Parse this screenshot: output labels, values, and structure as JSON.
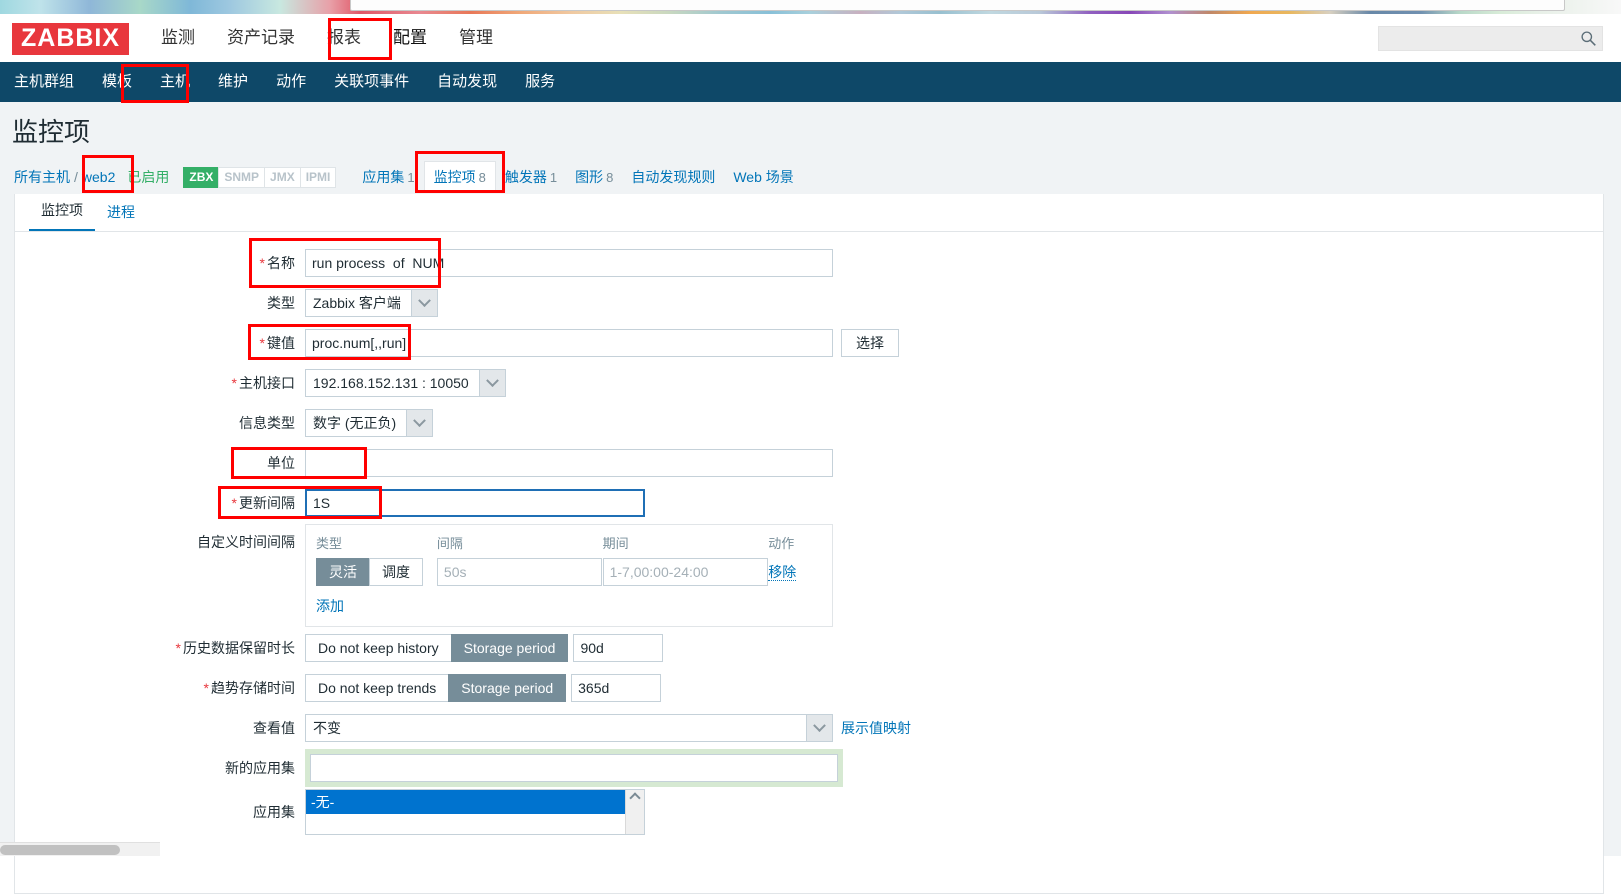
{
  "browser": {
    "wallpaper_strip": true
  },
  "header": {
    "logo": "ZABBIX",
    "menu": [
      {
        "label": "监测",
        "selected": false
      },
      {
        "label": "资产记录",
        "selected": false
      },
      {
        "label": "报表",
        "selected": false
      },
      {
        "label": "配置",
        "selected": true
      },
      {
        "label": "管理",
        "selected": false
      }
    ],
    "search": {
      "value": "",
      "placeholder": "",
      "icon": "search-icon"
    }
  },
  "subnav": {
    "items": [
      {
        "label": "主机群组",
        "selected": false
      },
      {
        "label": "模板",
        "selected": false
      },
      {
        "label": "主机",
        "selected": true
      },
      {
        "label": "维护",
        "selected": false
      },
      {
        "label": "动作",
        "selected": false
      },
      {
        "label": "关联项事件",
        "selected": false
      },
      {
        "label": "自动发现",
        "selected": false
      },
      {
        "label": "服务",
        "selected": false
      }
    ]
  },
  "page": {
    "title": "监控项"
  },
  "breadcrumb": {
    "all_hosts": "所有主机",
    "separator": "/",
    "host": "web2",
    "status": "已启用",
    "interface_tags": [
      {
        "label": "ZBX",
        "active": true
      },
      {
        "label": "SNMP",
        "active": false
      },
      {
        "label": "JMX",
        "active": false
      },
      {
        "label": "IPMI",
        "active": false
      }
    ],
    "object_tabs": [
      {
        "label": "应用集",
        "count": "1",
        "current": false
      },
      {
        "label": "监控项",
        "count": "8",
        "current": true
      },
      {
        "label": "触发器",
        "count": "1",
        "current": false
      },
      {
        "label": "图形",
        "count": "8",
        "current": false
      },
      {
        "label": "自动发现规则",
        "count": "",
        "current": false
      },
      {
        "label": "Web 场景",
        "count": "",
        "current": false
      }
    ]
  },
  "form_tabs": [
    {
      "label": "监控项",
      "active": true
    },
    {
      "label": "进程",
      "active": false
    }
  ],
  "form": {
    "name": {
      "label": "名称",
      "required": true,
      "value": "run process  of  NUM",
      "placeholder": ""
    },
    "type": {
      "label": "类型",
      "value": "Zabbix 客户端"
    },
    "key": {
      "label": "键值",
      "required": true,
      "value": "proc.num[,,run]",
      "placeholder": "",
      "select_button": "选择"
    },
    "host_interface": {
      "label": "主机接口",
      "required": true,
      "value": "192.168.152.131 : 10050"
    },
    "value_type": {
      "label": "信息类型",
      "value": "数字 (无正负)"
    },
    "units": {
      "label": "单位",
      "value": "",
      "placeholder": ""
    },
    "update_interval": {
      "label": "更新间隔",
      "required": true,
      "value": "1S",
      "focused": true
    },
    "custom_intervals": {
      "label": "自定义时间间隔",
      "columns": [
        "类型",
        "间隔",
        "期间",
        "动作"
      ],
      "rows": [
        {
          "type_options": [
            {
              "label": "灵活",
              "on": true
            },
            {
              "label": "调度",
              "on": false
            }
          ],
          "interval_value": "",
          "interval_placeholder": "50s",
          "period_value": "",
          "period_placeholder": "1-7,00:00-24:00",
          "action": "移除"
        }
      ],
      "add_label": "添加"
    },
    "history": {
      "label": "历史数据保留时长",
      "required": true,
      "options": [
        {
          "label": "Do not keep history",
          "on": false
        },
        {
          "label": "Storage period",
          "on": true
        }
      ],
      "value": "90d"
    },
    "trends": {
      "label": "趋势存储时间",
      "required": true,
      "options": [
        {
          "label": "Do not keep trends",
          "on": false
        },
        {
          "label": "Storage period",
          "on": true
        }
      ],
      "value": "365d"
    },
    "value_map": {
      "label": "查看值",
      "value": "不变",
      "link": "展示值映射"
    },
    "new_application": {
      "label": "新的应用集",
      "value": "",
      "placeholder": ""
    },
    "applications": {
      "label": "应用集",
      "options": [
        "-无-"
      ],
      "selected": "-无-"
    }
  },
  "annotations": {
    "color": "#ff0000",
    "boxes": [
      {
        "name": "config-menu-highlight"
      },
      {
        "name": "hosts-nav-highlight"
      },
      {
        "name": "host-name-highlight"
      },
      {
        "name": "items-tab-highlight"
      },
      {
        "name": "name-field-highlight"
      },
      {
        "name": "key-field-highlight"
      },
      {
        "name": "units-field-highlight"
      },
      {
        "name": "update-interval-highlight"
      }
    ]
  }
}
